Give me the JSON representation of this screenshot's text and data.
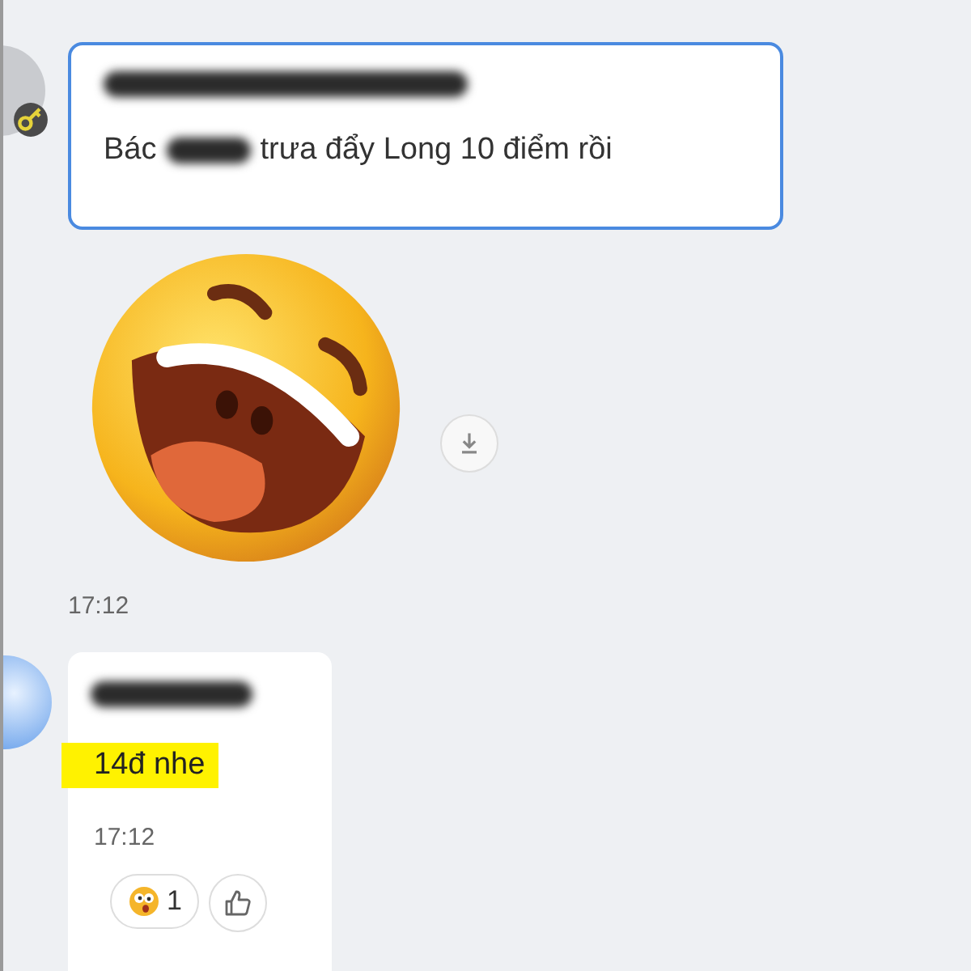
{
  "messages": [
    {
      "kind": "text",
      "border_focused": true,
      "text_before": "Bác",
      "text_after": "trưa đẩy Long 10 điểm rồi"
    },
    {
      "kind": "sticker",
      "time": "17:12"
    },
    {
      "kind": "reply",
      "text": "14đ nhe",
      "highlighted": true,
      "time": "17:12",
      "reactions": [
        {
          "count": "1"
        }
      ]
    }
  ]
}
